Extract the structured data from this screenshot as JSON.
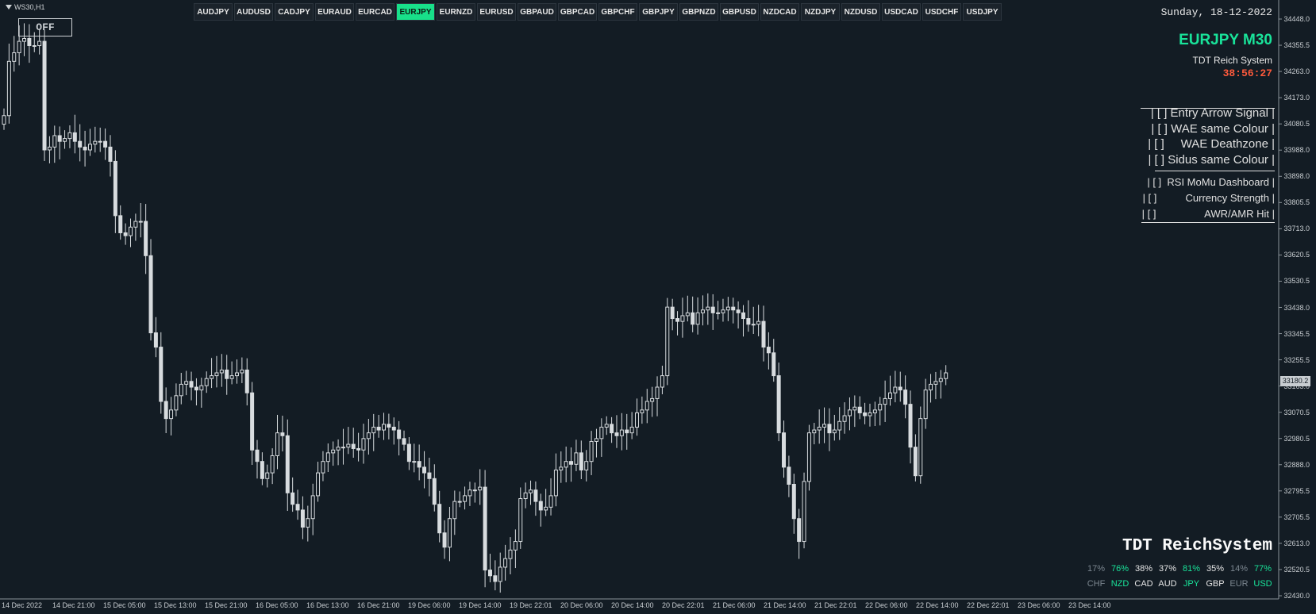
{
  "window": {
    "title": "WS30,H1"
  },
  "toolbar": {
    "off_button": "OFF",
    "symbols": [
      "AUDJPY",
      "AUDUSD",
      "CADJPY",
      "EURAUD",
      "EURCAD",
      "EURJPY",
      "EURNZD",
      "EURUSD",
      "GBPAUD",
      "GBPCAD",
      "GBPCHF",
      "GBPJPY",
      "GBPNZD",
      "GBPUSD",
      "NZDCAD",
      "NZDJPY",
      "NZDUSD",
      "USDCAD",
      "USDCHF",
      "USDJPY"
    ],
    "active_symbol": "EURJPY"
  },
  "header": {
    "date": "Sunday, 18-12-2022",
    "pair_title": "EURJPY M30",
    "system_name": "TDT Reich System",
    "timer": "38:56:27"
  },
  "panel": {
    "big_toggles": [
      "| [ ] Entry Arrow Signal |",
      "| [ ] WAE same Colour |",
      "| [ ]     WAE Deathzone |",
      "| [ ] Sidus same Colour |"
    ],
    "small_toggles": [
      "| [ ]  RSI MoMu Dashboard |",
      "| [ ]          Currency Strength |",
      "| [ ]                 AWR/AMR Hit |"
    ]
  },
  "strength": {
    "title": "TDT ReichSystem",
    "currencies": [
      {
        "pct": "17%",
        "code": "CHF",
        "color": "#7c8790"
      },
      {
        "pct": "76%",
        "code": "NZD",
        "color": "#19e39a"
      },
      {
        "pct": "38%",
        "code": "CAD",
        "color": "#e6e6e6"
      },
      {
        "pct": "37%",
        "code": "AUD",
        "color": "#e6e6e6"
      },
      {
        "pct": "81%",
        "code": "JPY",
        "color": "#19e39a"
      },
      {
        "pct": "35%",
        "code": "GBP",
        "color": "#e6e6e6"
      },
      {
        "pct": "14%",
        "code": "EUR",
        "color": "#7c8790"
      },
      {
        "pct": "77%",
        "code": "USD",
        "color": "#19e39a"
      }
    ]
  },
  "colors": {
    "background": "#131c24",
    "candle": "#d8dcdf",
    "accent": "#19e39a",
    "timer": "#ff5a3c"
  },
  "chart_data": {
    "type": "candlestick",
    "y_ticks": [
      "34448.0",
      "34355.5",
      "34263.0",
      "34173.0",
      "34080.5",
      "33988.0",
      "33898.0",
      "33805.5",
      "33713.0",
      "33620.5",
      "33530.5",
      "33438.0",
      "33345.5",
      "33255.5",
      "33163.0",
      "33070.5",
      "32980.5",
      "32888.0",
      "32795.5",
      "32705.5",
      "32613.0",
      "32520.5",
      "32430.0"
    ],
    "ylim": [
      32430.0,
      34448.0
    ],
    "x_ticks": [
      "14 Dec 2022",
      "14 Dec 21:00",
      "15 Dec 05:00",
      "15 Dec 13:00",
      "15 Dec 21:00",
      "16 Dec 05:00",
      "16 Dec 13:00",
      "16 Dec 21:00",
      "19 Dec 06:00",
      "19 Dec 14:00",
      "19 Dec 22:01",
      "20 Dec 06:00",
      "20 Dec 14:00",
      "20 Dec 22:01",
      "21 Dec 06:00",
      "21 Dec 14:00",
      "21 Dec 22:01",
      "22 Dec 06:00",
      "22 Dec 14:00",
      "22 Dec 22:01",
      "23 Dec 06:00",
      "23 Dec 14:00"
    ],
    "current_price": "33180.2",
    "closes": [
      34110,
      34300,
      34330,
      34370,
      34380,
      34355,
      34355,
      34370,
      33990,
      34000,
      34040,
      34020,
      34030,
      34050,
      34020,
      34000,
      33990,
      34010,
      34020,
      34020,
      34000,
      33950,
      33760,
      33700,
      33690,
      33720,
      33740,
      33740,
      33620,
      33350,
      33300,
      33110,
      33050,
      33080,
      33130,
      33170,
      33180,
      33160,
      33150,
      33165,
      33190,
      33200,
      33210,
      33220,
      33190,
      33200,
      33210,
      33220,
      33140,
      32940,
      32900,
      32840,
      32860,
      32920,
      33000,
      32990,
      32790,
      32750,
      32730,
      32670,
      32700,
      32780,
      32860,
      32900,
      32930,
      32940,
      32950,
      32950,
      32960,
      32945,
      32940,
      32980,
      33000,
      33020,
      33010,
      33030,
      33020,
      33010,
      32980,
      32960,
      32900,
      32900,
      32880,
      32860,
      32840,
      32750,
      32650,
      32600,
      32700,
      32760,
      32760,
      32780,
      32800,
      32800,
      32810,
      32520,
      32500,
      32480,
      32530,
      32560,
      32590,
      32620,
      32770,
      32790,
      32800,
      32760,
      32730,
      32740,
      32780,
      32870,
      32880,
      32900,
      32890,
      32930,
      32870,
      32900,
      32970,
      32980,
      33020,
      33030,
      33000,
      32990,
      33010,
      33000,
      33020,
      33070,
      33080,
      33110,
      33120,
      33160,
      33200,
      33440,
      33400,
      33390,
      33410,
      33420,
      33380,
      33420,
      33430,
      33440,
      33420,
      33420,
      33430,
      33440,
      33430,
      33420,
      33400,
      33380,
      33380,
      33390,
      33300,
      33280,
      33200,
      33000,
      32880,
      32820,
      32700,
      32620,
      32830,
      33000,
      33010,
      33020,
      33030,
      33000,
      33010,
      33040,
      33060,
      33080,
      33090,
      33070,
      33060,
      33070,
      33080,
      33100,
      33120,
      33140,
      33160,
      33150,
      33100,
      32950,
      32850,
      33050,
      33150,
      33170,
      33180,
      33190,
      33210
    ]
  }
}
